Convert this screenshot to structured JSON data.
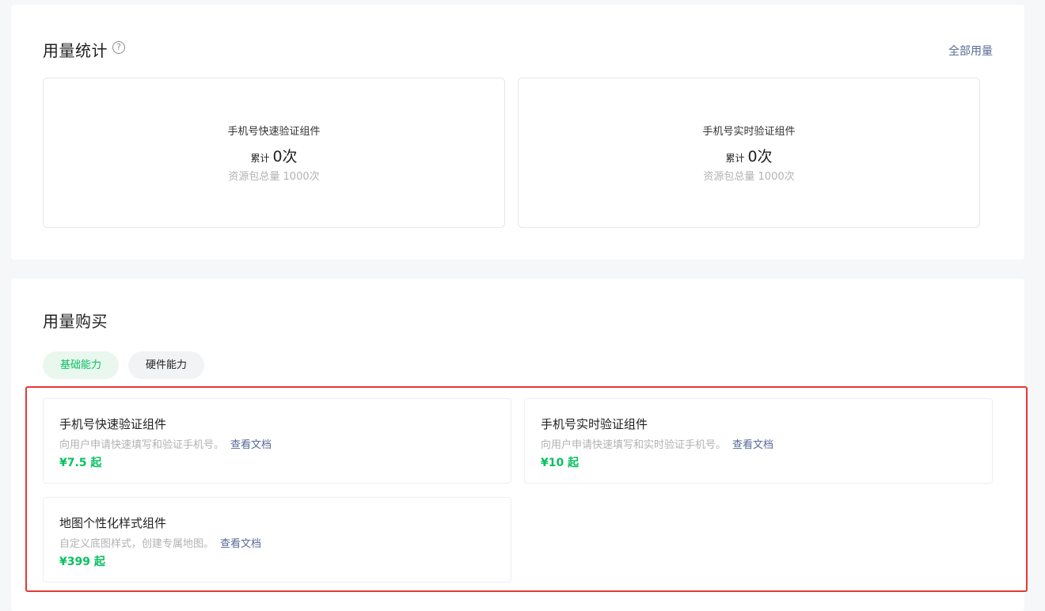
{
  "stats": {
    "title": "用量统计",
    "help_glyph": "?",
    "all_usage_link": "全部用量",
    "cards": [
      {
        "name": "手机号快速验证组件",
        "total_label": "累计",
        "total_value": "0次",
        "quota": "资源包总量 1000次"
      },
      {
        "name": "手机号实时验证组件",
        "total_label": "累计",
        "total_value": "0次",
        "quota": "资源包总量 1000次"
      }
    ]
  },
  "purchase": {
    "title": "用量购买",
    "tabs": [
      {
        "label": "基础能力",
        "active": true
      },
      {
        "label": "硬件能力",
        "active": false
      }
    ],
    "products": [
      {
        "name": "手机号快速验证组件",
        "desc": "向用户申请快速填写和验证手机号。",
        "doc_link": "查看文档",
        "price": "¥7.5 起"
      },
      {
        "name": "手机号实时验证组件",
        "desc": "向用户申请快速填写和实时验证手机号。",
        "doc_link": "查看文档",
        "price": "¥10 起"
      },
      {
        "name": "地图个性化样式组件",
        "desc": "自定义底图样式，创建专属地图。",
        "doc_link": "查看文档",
        "price": "¥399 起"
      }
    ]
  },
  "colors": {
    "accent_green": "#07c160",
    "link_blue": "#576b95",
    "highlight_red": "#e53935"
  }
}
